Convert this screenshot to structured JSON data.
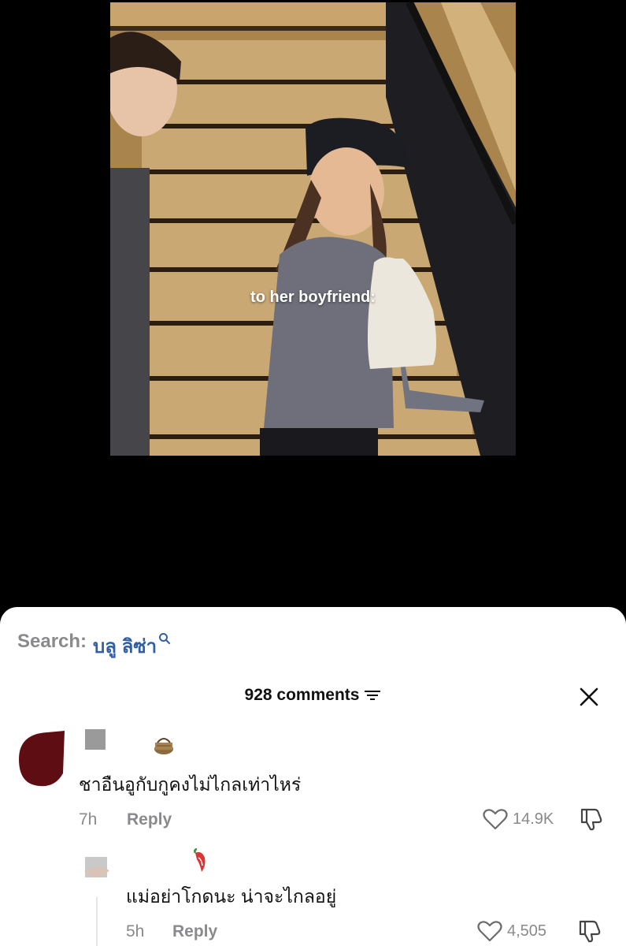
{
  "video": {
    "caption": "to her boyfriend:"
  },
  "search": {
    "prefix": "Search:",
    "term": "บลู ลิซ่า"
  },
  "comments_header": {
    "title": "928 comments"
  },
  "comments": [
    {
      "text": "ชาอืนอูกับกูคงไม่ไกลเท่าไหร่",
      "time": "7h",
      "reply_label": "Reply",
      "likes": "14.9K"
    },
    {
      "text": "แม่อย่าโกดนะ น่าจะไกลอยู่",
      "time": "5h",
      "reply_label": "Reply",
      "likes": "4,505"
    }
  ],
  "icons": {
    "search": "search-icon",
    "filter": "filter-icon",
    "close": "close-icon",
    "heart": "heart-icon",
    "dislike": "dislike-icon"
  },
  "colors": {
    "search_term": "#2f5fa6",
    "avatar_main": "#5e0e12",
    "muted": "#8a8a8e"
  }
}
